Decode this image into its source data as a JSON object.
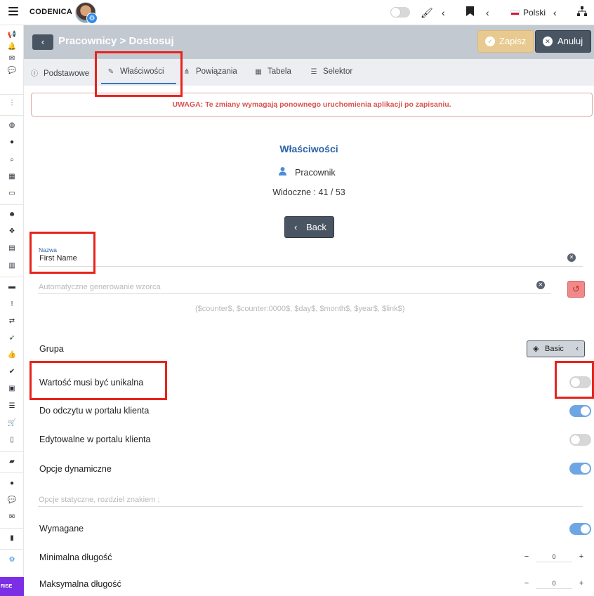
{
  "topbar": {
    "brand": "CODENICA",
    "language": "Polski"
  },
  "sidebar": {
    "badge": "RISE"
  },
  "header": {
    "breadcrumb": "Pracownicy > Dostosuj",
    "save_label": "Zapisz",
    "cancel_label": "Anuluj"
  },
  "tabs": [
    {
      "label": "Podstawowe"
    },
    {
      "label": "Właściwości"
    },
    {
      "label": "Powiązania"
    },
    {
      "label": "Tabela"
    },
    {
      "label": "Selektor"
    }
  ],
  "alert": "UWAGA: Te zmiany wymagają ponownego uruchomienia aplikacji po zapisaniu.",
  "section": {
    "title": "Właściwości",
    "entity": "Pracownik",
    "visible_count": "Widoczne : 41 / 53",
    "back_label": "Back"
  },
  "form": {
    "name_label": "Nazwa",
    "name_value": "First Name",
    "pattern_placeholder": "Automatyczne generowanie wzorca",
    "pattern_hint": "($counter$, $counter:0000$, $day$, $month$, $year$, $link$)",
    "group_label": "Grupa",
    "group_value": "Basic",
    "unique_label": "Wartość musi być unikalna",
    "unique_on": false,
    "readonly_portal_label": "Do odczytu w portalu klienta",
    "readonly_portal_on": true,
    "editable_portal_label": "Edytowalne w portalu klienta",
    "editable_portal_on": false,
    "dynamic_options_label": "Opcje dynamiczne",
    "dynamic_options_on": true,
    "static_options_placeholder": "Opcje statyczne, rozdziel znakiem ;",
    "required_label": "Wymagane",
    "required_on": true,
    "min_length_label": "Minimalna długość",
    "min_length_value": "0",
    "max_length_label": "Maksymalna długość",
    "max_length_value": "0"
  },
  "colors": {
    "accent": "#2b63a8",
    "toggle_on": "#6ea6e3",
    "warning": "#d9534f",
    "annotation": "#e8231b"
  }
}
